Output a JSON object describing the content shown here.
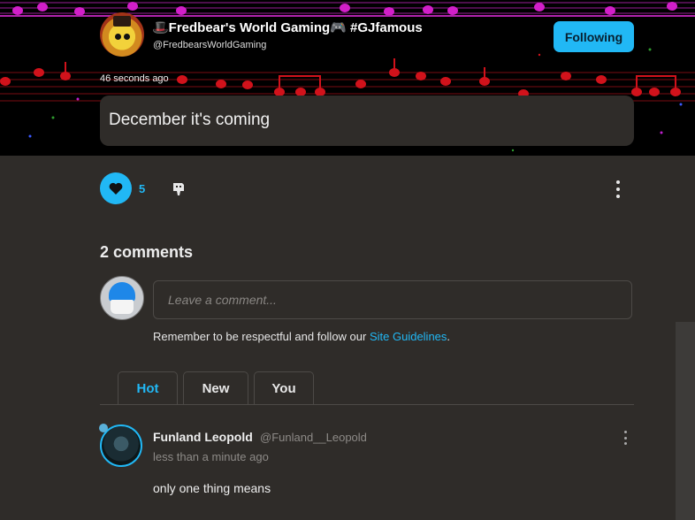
{
  "post": {
    "author_name": "🎩Fredbear's World Gaming🎮 #GJfamous",
    "author_handle": "@FredbearsWorldGaming",
    "follow_label": "Following",
    "time_ago": "46 seconds ago",
    "text": "December it's coming",
    "like_count": "5"
  },
  "comments_section": {
    "heading": "2 comments",
    "input_placeholder": "Leave a comment...",
    "guidelines_prefix": "Remember to be respectful and follow our ",
    "guidelines_link": "Site Guidelines",
    "guidelines_suffix": ".",
    "tabs": [
      {
        "label": "Hot",
        "active": true
      },
      {
        "label": "New",
        "active": false
      },
      {
        "label": "You",
        "active": false
      }
    ]
  },
  "comments": [
    {
      "name": "Funland Leopold",
      "handle": "@Funland__Leopold",
      "time": "less than a minute ago",
      "text": "only one thing means"
    }
  ],
  "colors": {
    "accent": "#21b8f5",
    "background": "#2f2c29",
    "banner_notes_magenta": "#d21fc9",
    "banner_notes_red": "#d1121b"
  },
  "icons": [
    "heart-icon",
    "dislike-icon",
    "more-vertical-icon"
  ]
}
